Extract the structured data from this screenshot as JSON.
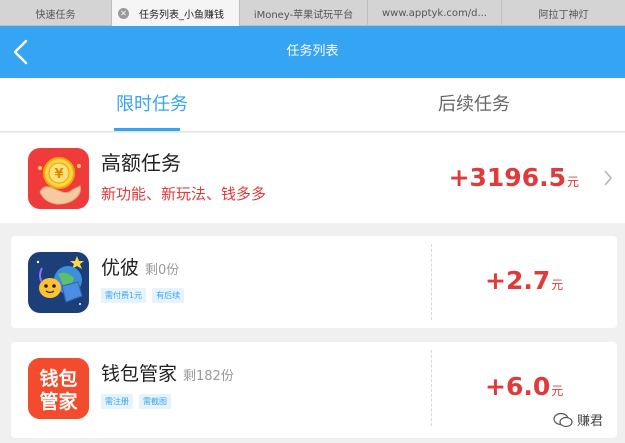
{
  "browser": {
    "tabs": [
      {
        "label": "快速任务"
      },
      {
        "label": "任务列表_小鱼赚钱"
      },
      {
        "label": "iMoney-苹果试玩平台"
      },
      {
        "label": "www.apptyk.com/d..."
      },
      {
        "label": "阿拉丁神灯"
      }
    ]
  },
  "nav": {
    "title": "任务列表"
  },
  "segments": {
    "tab1": "限时任务",
    "tab2": "后续任务"
  },
  "featured": {
    "title": "高额任务",
    "subtitle": "新功能、新玩法、钱多多",
    "amount": "+3196.5",
    "unit": "元"
  },
  "tasks": [
    {
      "name": "优彼",
      "remaining": "剩0份",
      "tags": [
        "需付费1元",
        "有后续"
      ],
      "amount": "+2.7",
      "unit": "元",
      "icon_text": ""
    },
    {
      "name": "钱包管家",
      "remaining": "剩182份",
      "tags": [
        "需注册",
        "需截图"
      ],
      "amount": "+6.0",
      "unit": "元",
      "icon_text": "钱包管家"
    }
  ],
  "watermark": {
    "text": "赚君"
  },
  "colors": {
    "accent": "#35a4f2",
    "price": "#e03a3a"
  }
}
